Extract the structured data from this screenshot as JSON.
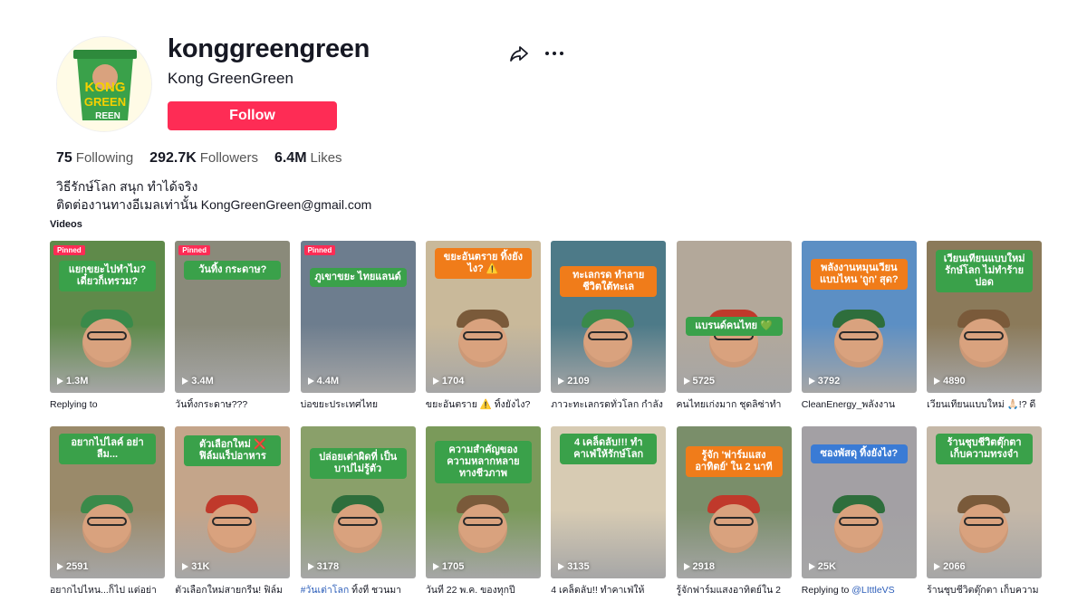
{
  "profile": {
    "username": "konggreengreen",
    "nickname": "Kong GreenGreen",
    "follow_label": "Follow",
    "avatar_text_line1": "KONG",
    "avatar_text_line2": "GREEN",
    "avatar_text_line3": "REEN"
  },
  "stats": [
    {
      "value": "75",
      "label": "Following"
    },
    {
      "value": "292.7K",
      "label": "Followers"
    },
    {
      "value": "6.4M",
      "label": "Likes"
    }
  ],
  "bio": {
    "line1": "วิธีรักษ์โลก สนุก ทำได้จริง",
    "line2": "ติดต่องานทางอีเมลเท่านั้น KongGreenGreen@gmail.com"
  },
  "videos_label": "Videos",
  "pinned_label": "Pinned",
  "icons": {
    "share": "share-icon",
    "more": "more-icon",
    "play": "play-icon"
  },
  "colors": {
    "accent": "#fe2c55",
    "banner_green": "#3aa14a",
    "banner_orange": "#f07c1a"
  },
  "videos": [
    {
      "views": "1.3M",
      "caption": "Replying to",
      "pinned": true,
      "banner": "แยกขยะไปทำไม? เดี๋ยวก็เทรวม?",
      "banner_color": "#3aa14a",
      "bg": "#5f8a4a"
    },
    {
      "views": "3.4M",
      "caption": "วันทิ้งกระดาษ???",
      "pinned": true,
      "banner": "วันทิ้ง กระดาษ?",
      "banner_color": "#3aa14a",
      "bg": "#8a8a7a"
    },
    {
      "views": "4.4M",
      "caption": "บ่อขยะประเทศไทย",
      "pinned": true,
      "banner": "ภูเขาขยะ ไทยแลนด์",
      "banner_color": "#3aa14a",
      "bg": "#6d7d8e"
    },
    {
      "views": "1704",
      "caption": "ขยะอันตราย ⚠️ ทิ้งยังไง?",
      "pinned": false,
      "banner": "ขยะอันตราย ทิ้งยังไง? ⚠️",
      "banner_color": "#f07c1a",
      "bg": "#c9b99a"
    },
    {
      "views": "2109",
      "caption": "ภาวะทะเลกรดทั่วโลก กำลัง",
      "pinned": false,
      "banner": "ทะเลกรด ทำลายชีวิตใต้ทะเล",
      "banner_color": "#f07c1a",
      "bg": "#4d7a88"
    },
    {
      "views": "5725",
      "caption": "คนไทยเก่งมาก ชุดลิซ่าทำ",
      "pinned": false,
      "banner": "แบรนด์คนไทย 💚",
      "banner_color": "#3aa14a",
      "bg": "#b3a89a"
    },
    {
      "views": "3792",
      "caption": "CleanEnergy_พลังงาน",
      "pinned": false,
      "banner": "พลังงานหมุนเวียน แบบไหน 'ถูก' สุด?",
      "banner_color": "#f07c1a",
      "bg": "#5c8fc4"
    },
    {
      "views": "4890",
      "caption": "เวียนเทียนแบบใหม่ 🙏🏻!? ดี",
      "pinned": false,
      "banner": "เวียนเทียนแบบใหม่ รักษ์โลก ไม่ทำร้ายปอด",
      "banner_color": "#3aa14a",
      "bg": "#8b7a5a"
    },
    {
      "views": "2591",
      "caption": "อยากไปไหน...ก็ไป แต่อย่า",
      "pinned": false,
      "banner": "อยากไปไลค์ อย่าลืม...",
      "banner_color": "#3aa14a",
      "bg": "#9a8a6a"
    },
    {
      "views": "31K",
      "caption": "ตัวเลือกใหม่สายกรีน! ฟิล์ม",
      "pinned": false,
      "banner": "ตัวเลือกใหม่ ❌ ฟิล์มแร็ปอาหาร",
      "banner_color": "#3aa14a",
      "bg": "#c4a58a"
    },
    {
      "views": "3178",
      "caption": "#วันเต่าโลก ทิ้งที่ ชวนมา",
      "pinned": false,
      "banner": "ปล่อยเต่าผิดที่ เป็นบาปไม่รู้ตัว",
      "banner_color": "#3aa14a",
      "bg": "#8aa06a",
      "tag": "#วันเต่าโลก",
      "rest": " ทิ้งที่ ชวนมา"
    },
    {
      "views": "1705",
      "caption": "วันที่ 22 พ.ค. ของทุกปี",
      "pinned": false,
      "banner": "ความสำคัญของ ความหลากหลาย ทางชีวภาพ",
      "banner_color": "#3aa14a",
      "bg": "#7a9a5a"
    },
    {
      "views": "3135",
      "caption": "4 เคล็ดลับ!! ทำคาเฟ่ให้",
      "pinned": false,
      "banner": "4 เคล็ดลับ!!! ทำคาเฟ่ให้รักษ์โลก",
      "banner_color": "#3aa14a",
      "bg": "#d7cbb3"
    },
    {
      "views": "2918",
      "caption": "รู้จักฟาร์มแสงอาทิตย์ใน 2",
      "pinned": false,
      "banner": "รู้จัก 'ฟาร์มแสงอาทิตย์' ใน 2 นาที",
      "banner_color": "#f07c1a",
      "bg": "#7a8e6a"
    },
    {
      "views": "25K",
      "caption": "Replying to @LIttleVS",
      "pinned": false,
      "banner": "ซองพัสดุ ทิ้งยังไง?",
      "banner_color": "#3a7bd5",
      "bg": "#a3a0a4",
      "tag": "@LIttleVS",
      "rest_before": "Replying to "
    },
    {
      "views": "2066",
      "caption": "ร้านชุบชีวิตตุ๊กตา เก็บความ",
      "pinned": false,
      "banner": "ร้านชุบชีวิตตุ๊กตา เก็บความทรงจำ",
      "banner_color": "#3aa14a",
      "bg": "#c5b8a8"
    }
  ]
}
